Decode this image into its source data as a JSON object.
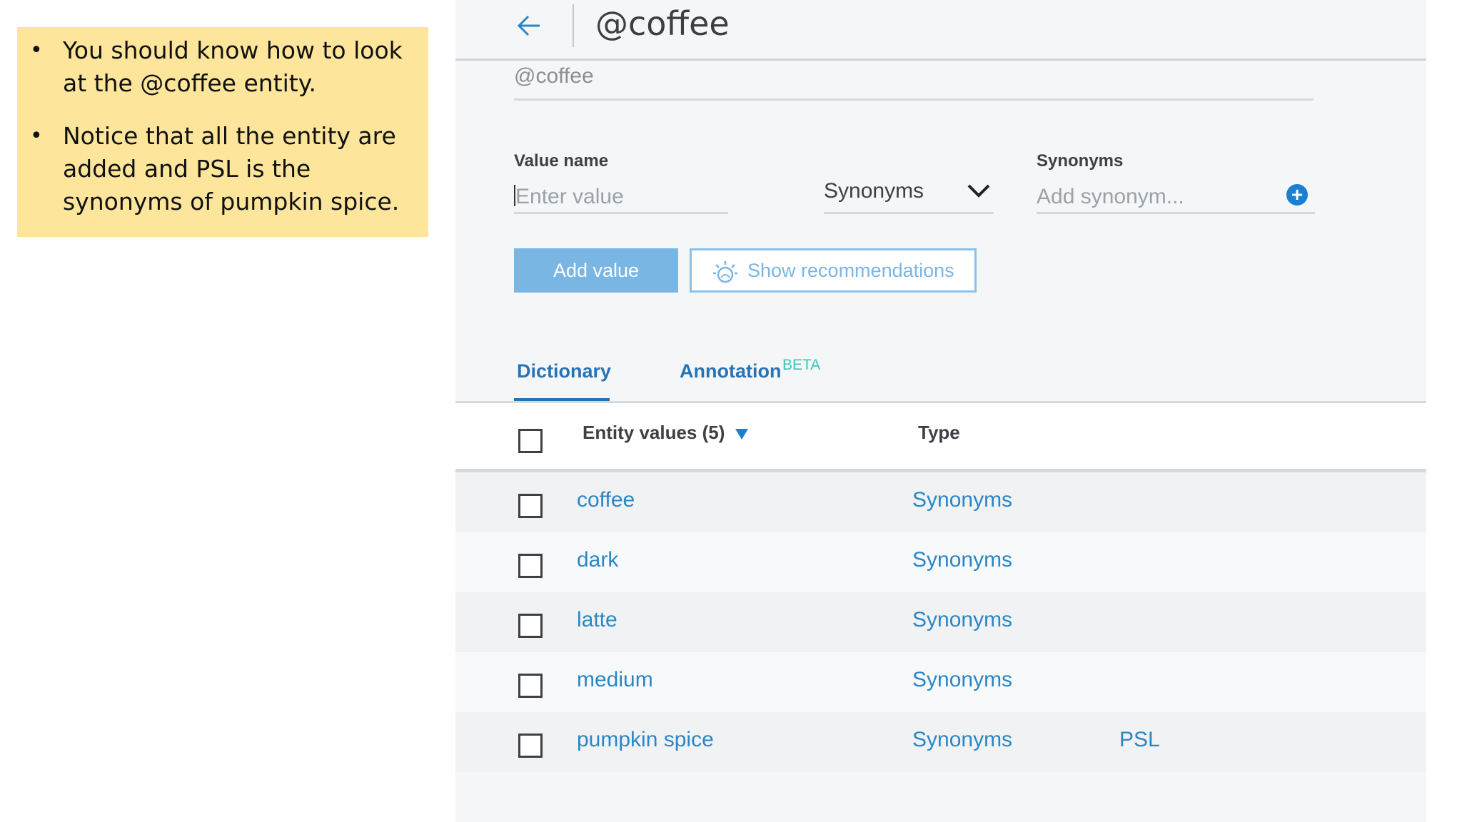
{
  "note": {
    "bullets": [
      "You should know how to look at the @coffee entity.",
      "Notice that all the entity are added and PSL is the synonyms of pumpkin spice."
    ]
  },
  "header": {
    "title": "@coffee"
  },
  "entity": {
    "name": "@coffee"
  },
  "form": {
    "value_name_label": "Value name",
    "value_placeholder": "Enter value",
    "type_select_value": "Synonyms",
    "synonyms_label": "Synonyms",
    "synonym_placeholder": "Add synonym...",
    "add_value_label": "Add value",
    "show_recommendations_label": "Show recommendations"
  },
  "tabs": {
    "dictionary": "Dictionary",
    "annotation": "Annotation",
    "annotation_badge": "BETA"
  },
  "table": {
    "col_values": "Entity values (5)",
    "col_type": "Type",
    "rows": [
      {
        "value": "coffee",
        "type": "Synonyms",
        "synonyms": ""
      },
      {
        "value": "dark",
        "type": "Synonyms",
        "synonyms": ""
      },
      {
        "value": "latte",
        "type": "Synonyms",
        "synonyms": ""
      },
      {
        "value": "medium",
        "type": "Synonyms",
        "synonyms": ""
      },
      {
        "value": "pumpkin spice",
        "type": "Synonyms",
        "synonyms": "PSL"
      }
    ]
  },
  "colors": {
    "accent": "#2873b4",
    "link": "#2a87c6",
    "note_bg": "#fde69b"
  }
}
